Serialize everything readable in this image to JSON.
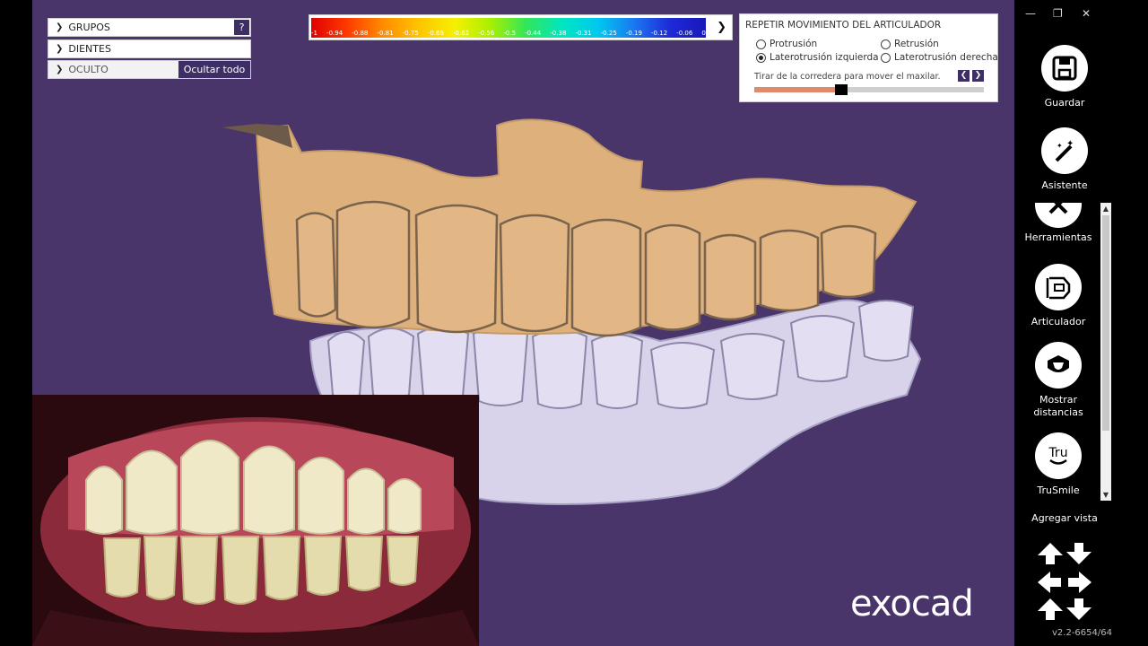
{
  "left_panel": {
    "groups_label": "GRUPOS",
    "help_label": "?",
    "teeth_label": "DIENTES",
    "hidden_label": "OCULTO",
    "hide_all_label": "Ocultar todo"
  },
  "color_scale": {
    "ticks": [
      "-1",
      "-0.94",
      "-0.88",
      "-0.81",
      "-0.75",
      "-0.69",
      "-0.62",
      "-0.56",
      "-0.5",
      "-0.44",
      "-0.38",
      "-0.31",
      "-0.25",
      "-0.19",
      "-0.12",
      "-0.06",
      "0"
    ]
  },
  "articulator": {
    "title": "REPETIR MOVIMIENTO DEL ARTICULADOR",
    "options": {
      "protrusion": "Protrusión",
      "retrusion": "Retrusión",
      "left_laterotrusion": "Laterotrusión izquierda",
      "right_laterotrusion": "Laterotrusión derecha"
    },
    "selected": "left_laterotrusion",
    "hint": "Tirar de la corredera para mover el maxilar.",
    "slider_value": 0.38
  },
  "brand": "exocad",
  "toolbar": {
    "save": "Guardar",
    "wizard": "Asistente",
    "tools": "Herramientas",
    "articulator": "Articulador",
    "distances": "Mostrar distancias",
    "trusmile": "TruSmile",
    "trusmile_icon_text": "Tru",
    "add_view": "Agregar vista",
    "version": "v2.2-6654/64"
  }
}
